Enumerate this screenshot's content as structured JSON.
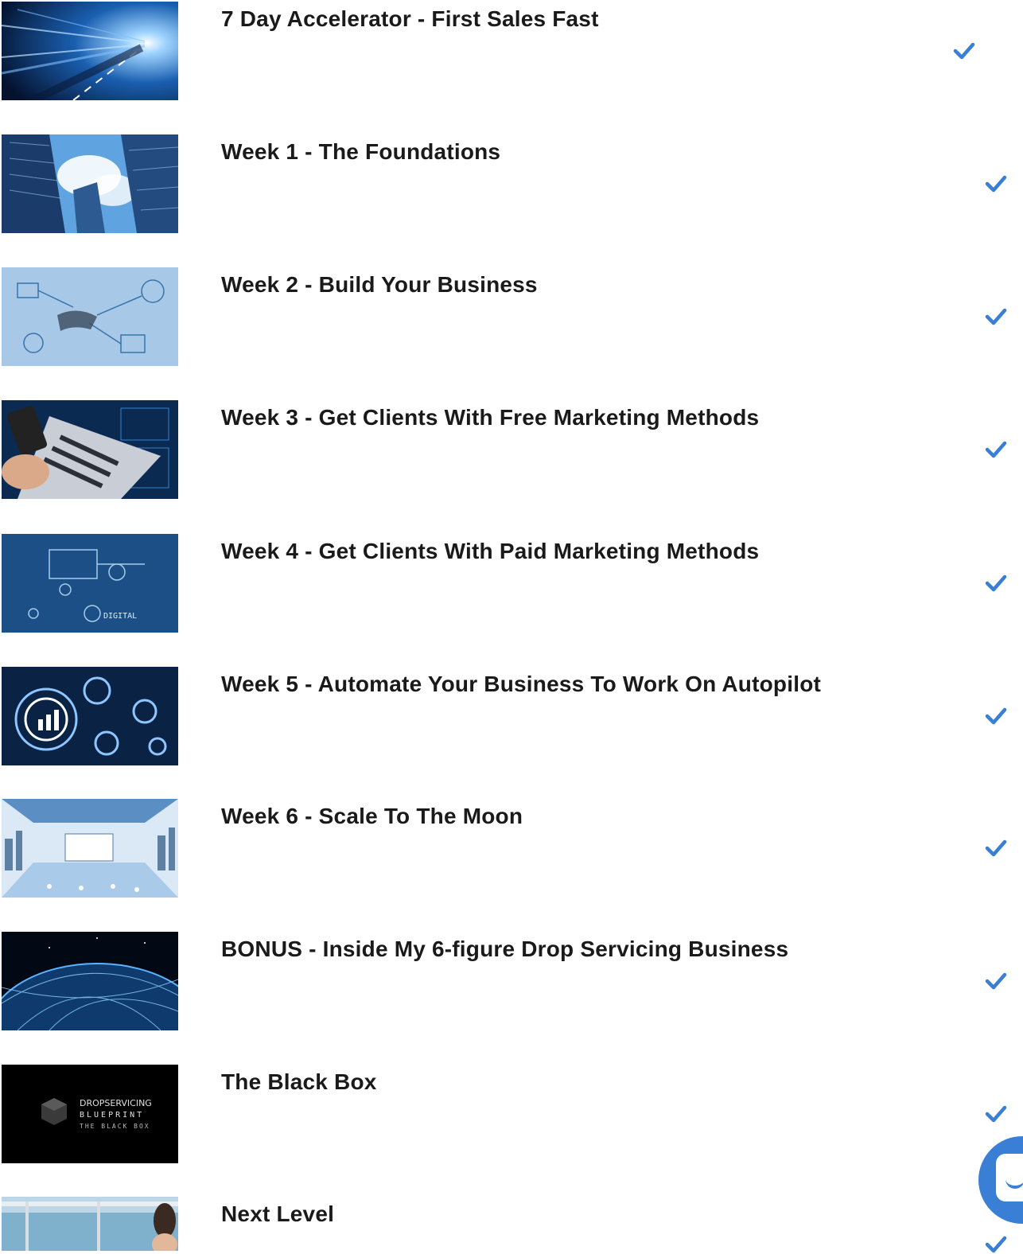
{
  "accent_color": "#3a7fd6",
  "modules": [
    {
      "title": "7 Day Accelerator - First Sales Fast",
      "completed": true,
      "thumbnail_icon": "light-speed-road-image"
    },
    {
      "title": "Week 1 - The Foundations",
      "completed": true,
      "thumbnail_icon": "skyscrapers-sky-image"
    },
    {
      "title": "Week 2 - Build Your Business",
      "completed": true,
      "thumbnail_icon": "hand-drawing-diagram-image"
    },
    {
      "title": "Week 3 - Get Clients With Free Marketing Methods",
      "completed": true,
      "thumbnail_icon": "laptop-phone-image"
    },
    {
      "title": "Week 4 - Get Clients With Paid Marketing Methods",
      "completed": true,
      "thumbnail_icon": "digital-marketing-image"
    },
    {
      "title": "Week 5 - Automate Your Business To Work On Autopilot",
      "completed": true,
      "thumbnail_icon": "gears-automation-image"
    },
    {
      "title": "Week 6 - Scale To The Moon",
      "completed": true,
      "thumbnail_icon": "futuristic-room-image"
    },
    {
      "title": "BONUS - Inside My 6-figure Drop Servicing Business",
      "completed": true,
      "thumbnail_icon": "network-globe-image"
    },
    {
      "title": "The Black Box",
      "completed": true,
      "thumbnail_icon": "black-box-logo-image"
    },
    {
      "title": "Next Level",
      "completed": true,
      "thumbnail_icon": "ocean-view-image"
    }
  ],
  "black_box_logo": {
    "line1": "DROPSERVICING",
    "line2": "BLUEPRINT",
    "line3": "THE BLACK BOX"
  },
  "chat_widget": {
    "icon": "chat-icon"
  }
}
